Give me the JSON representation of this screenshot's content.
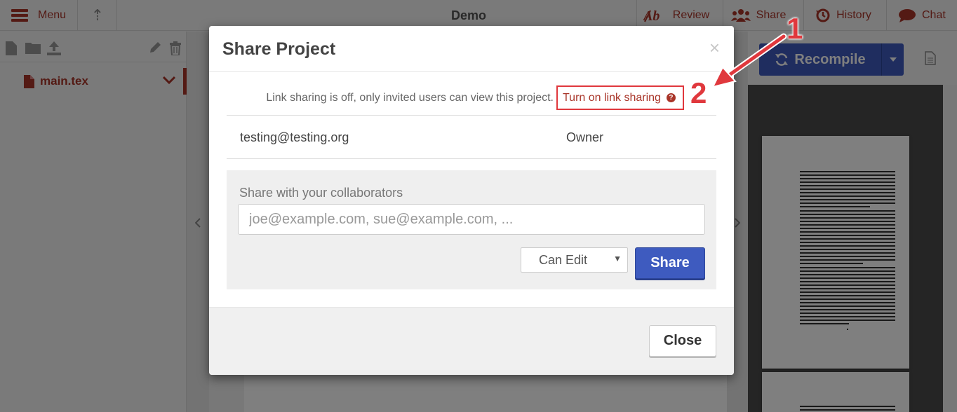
{
  "toolbar": {
    "menu_label": "Menu",
    "project_title": "Demo",
    "review_label": "Review",
    "share_label": "Share",
    "history_label": "History",
    "chat_label": "Chat"
  },
  "file_tree": {
    "files": [
      {
        "name": "main.tex"
      }
    ]
  },
  "preview": {
    "recompile_label": "Recompile"
  },
  "modal": {
    "title": "Share Project",
    "close_x": "×",
    "link_sharing_status": "Link sharing is off, only invited users can view this project.",
    "link_sharing_action": "Turn on link sharing",
    "help_glyph": "?",
    "members": [
      {
        "email": "testing@testing.org",
        "role": "Owner"
      }
    ],
    "share_with_label": "Share with your collaborators",
    "share_placeholder": "joe@example.com, sue@example.com, ...",
    "permission_selected": "Can Edit",
    "share_button": "Share",
    "close_button": "Close"
  },
  "annotations": {
    "step1": "1",
    "step2": "2"
  },
  "colors": {
    "brand_red": "#a93529",
    "primary_blue": "#3e5bbf",
    "annotation_red": "#e0383d"
  }
}
